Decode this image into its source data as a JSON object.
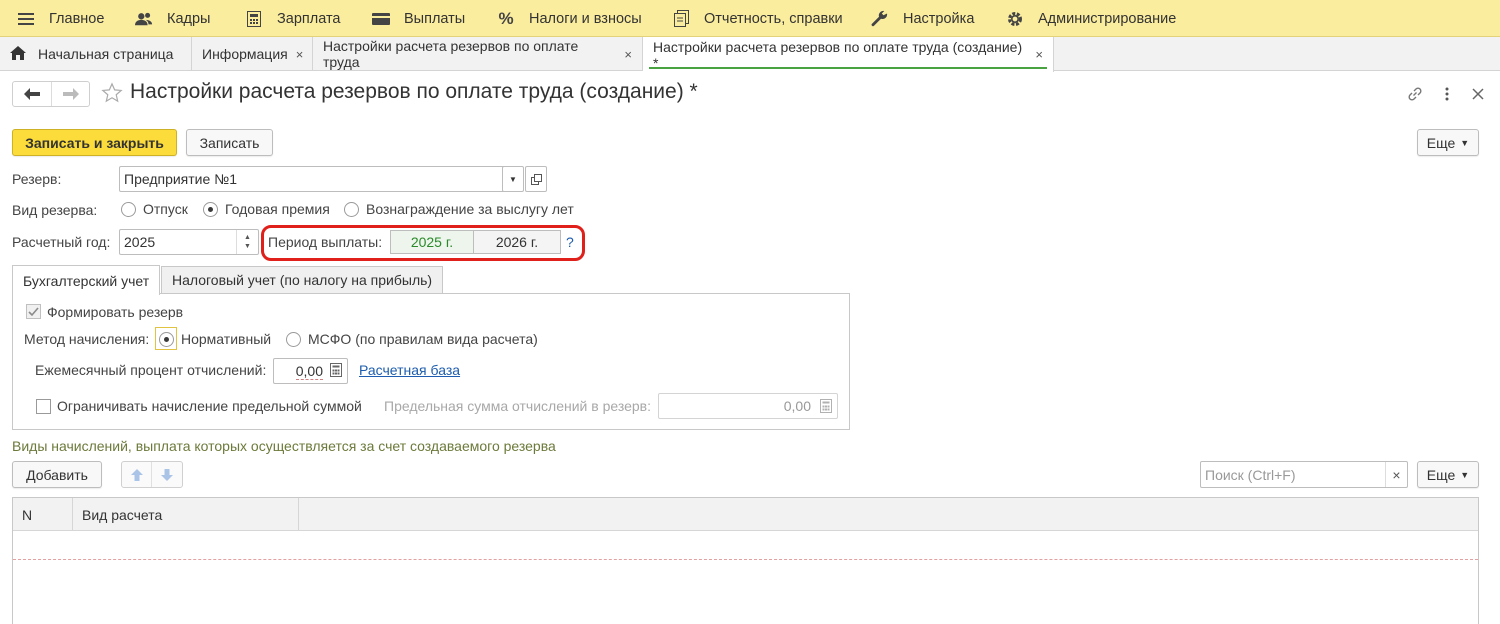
{
  "menu": {
    "items": [
      {
        "label": "Главное",
        "icon": "hamburger-icon"
      },
      {
        "label": "Кадры",
        "icon": "people-icon"
      },
      {
        "label": "Зарплата",
        "icon": "calculator-icon"
      },
      {
        "label": "Выплаты",
        "icon": "wallet-icon"
      },
      {
        "label": "Налоги и взносы",
        "icon": "percent-icon"
      },
      {
        "label": "Отчетность, справки",
        "icon": "documents-icon"
      },
      {
        "label": "Настройка",
        "icon": "wrench-icon"
      },
      {
        "label": "Администрирование",
        "icon": "gear-icon"
      }
    ]
  },
  "tabs": {
    "home": "Начальная страница",
    "info": "Информация",
    "settings": "Настройки расчета резервов по оплате труда",
    "settings_create": "Настройки расчета резервов по оплате труда (создание) *",
    "close": "×"
  },
  "header": {
    "title": "Настройки расчета резервов по оплате труда (создание) *"
  },
  "toolbar": {
    "save_close": "Записать и закрыть",
    "save": "Записать",
    "more": "Еще"
  },
  "form": {
    "reserve_label": "Резерв:",
    "reserve_value": "Предприятие №1",
    "type_label": "Вид резерва:",
    "type_options": [
      "Отпуск",
      "Годовая премия",
      "Вознаграждение за выслугу лет"
    ],
    "type_selected": "Годовая премия",
    "year_label": "Расчетный год:",
    "year_value": "2025",
    "period_label": "Период выплаты:",
    "period_options": [
      "2025 г.",
      "2026 г."
    ],
    "help": "?"
  },
  "inner_tabs": {
    "accounting": "Бухгалтерский учет",
    "tax": "Налоговый учет (по налогу на прибыль)"
  },
  "accounting": {
    "form_reserve": "Формировать резерв",
    "method_label": "Метод начисления:",
    "method_options": [
      "Нормативный",
      "МСФО (по правилам вида расчета)"
    ],
    "method_selected": "Нормативный",
    "monthly_label": "Ежемесячный процент отчислений:",
    "monthly_value": "0,00",
    "base_link": "Расчетная база",
    "limit_label": "Ограничивать начисление предельной суммой",
    "limit_sum_label": "Предельная сумма отчислений в резерв:",
    "limit_sum_value": "0,00"
  },
  "accruals": {
    "title": "Виды начислений, выплата которых осуществляется за счет создаваемого резерва",
    "add": "Добавить",
    "search_placeholder": "Поиск (Ctrl+F)",
    "clear": "×",
    "more": "Еще",
    "columns": [
      "N",
      "Вид расчета"
    ]
  },
  "colors": {
    "menu_bg": "#fbed9e",
    "primary_button": "#fbdc3b",
    "highlight": "#e0201a",
    "active_tab_underline": "#49a340",
    "period_selected_text": "#2a8a2a",
    "link": "#1d5cae",
    "section_title": "#6b7a3a"
  }
}
